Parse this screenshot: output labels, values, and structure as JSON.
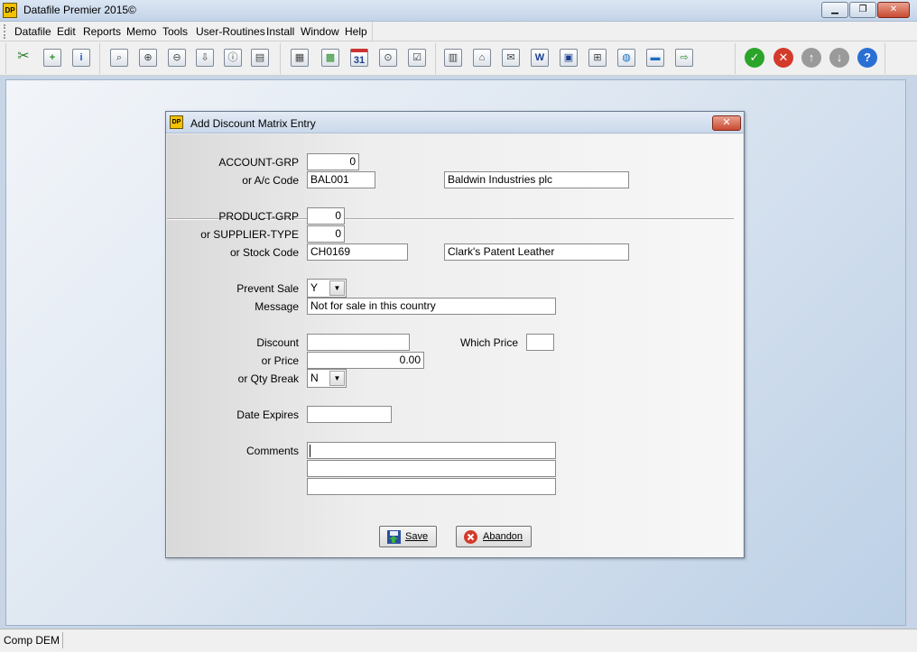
{
  "window": {
    "title": "Datafile  Premier 2015©",
    "icon_text": "DP"
  },
  "menu": [
    "Datafile",
    "Edit",
    "Reports",
    "Memo",
    "Tools",
    "User-Routines",
    "Install",
    "Window",
    "Help"
  ],
  "toolbar": {
    "icons": [
      "scissors-icon",
      "new-record-icon",
      "record-info-icon",
      "find-icon",
      "add-window-icon",
      "remove-window-icon",
      "import-icon",
      "window-info-icon",
      "print-icon",
      "document-icon",
      "calculator-icon",
      "calendar-icon",
      "inspect-icon",
      "checklist-icon",
      "chart-icon",
      "home-icon",
      "email-icon",
      "word-doc-icon",
      "picture-icon",
      "add-screen-icon",
      "internet-icon",
      "car-icon",
      "export-icon",
      "ok-icon",
      "cancel-icon",
      "up-icon",
      "down-icon",
      "help-icon"
    ],
    "calendar_text": "31"
  },
  "dialog": {
    "title": "Add Discount Matrix Entry",
    "account_grp": {
      "label": "ACCOUNT-GRP",
      "value": "0"
    },
    "ac_code": {
      "label": "or A/c Code",
      "value": "BAL001",
      "description": "Baldwin Industries plc"
    },
    "product_grp": {
      "label": "PRODUCT-GRP",
      "value": "0"
    },
    "supplier_type": {
      "label": "or SUPPLIER-TYPE",
      "value": "0"
    },
    "stock_code": {
      "label": "or Stock Code",
      "value": "CH0169",
      "description": "Clark's Patent Leather"
    },
    "prevent_sale": {
      "label": "Prevent Sale",
      "value": "Y"
    },
    "message": {
      "label": "Message",
      "value": "Not for sale in this country"
    },
    "discount": {
      "label": "Discount",
      "value": ""
    },
    "which_price": {
      "label": "Which Price",
      "value": ""
    },
    "price": {
      "label": "or Price",
      "value": "0.00"
    },
    "qty_break": {
      "label": "or Qty Break",
      "value": "N"
    },
    "date_expires": {
      "label": "Date Expires",
      "value": ""
    },
    "comments": {
      "label": "Comments",
      "lines": [
        "",
        "",
        ""
      ]
    },
    "save_label": "Save",
    "abandon_label": "Abandon"
  },
  "status": {
    "company": "Comp DEM"
  }
}
